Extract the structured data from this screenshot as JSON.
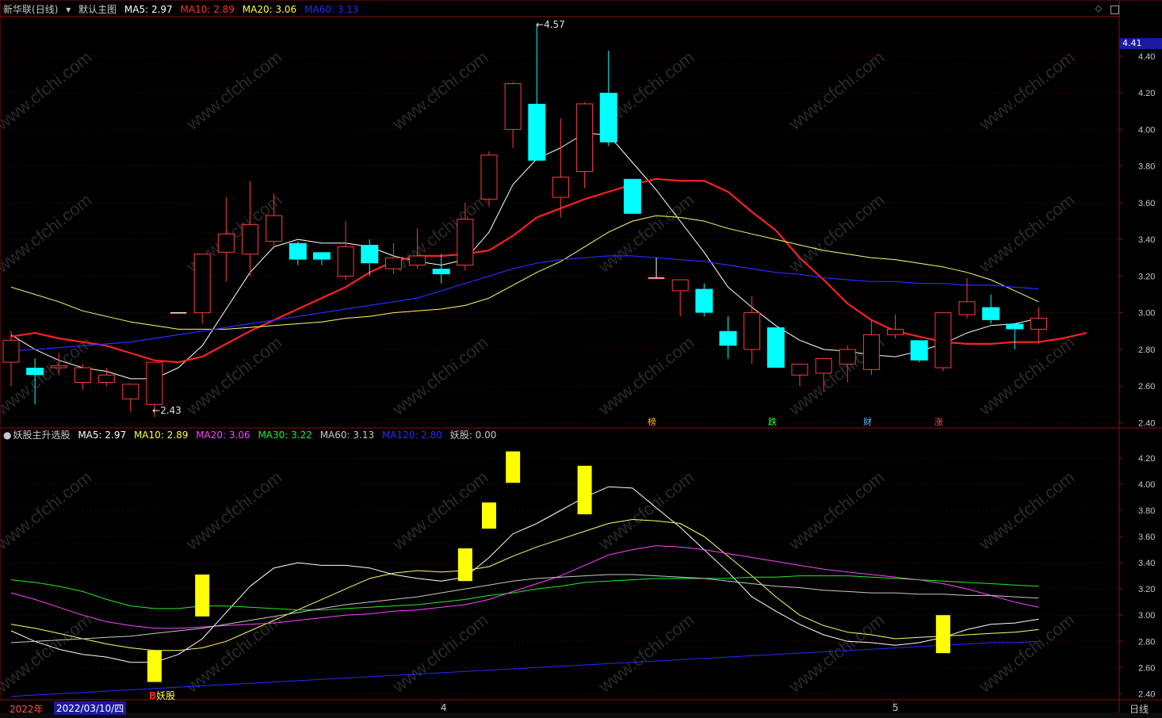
{
  "top_panel": {
    "stock_name": "新华联",
    "period": "(日线)",
    "main_chart_label": "默认主图",
    "ma5": "MA5: 2.97",
    "ma10": "MA10: 2.89",
    "ma20": "MA20: 3.06",
    "ma60": "MA60: 3.13",
    "current_price": "4.41",
    "high_label": "4.57",
    "low_label": "2.43",
    "event_markers": [
      "榜",
      "跌",
      "财",
      "涨"
    ]
  },
  "bottom_panel": {
    "indicator_name": "妖股主升选股",
    "ma5": "MA5: 2.97",
    "ma10": "MA10: 2.89",
    "ma20": "MA20: 3.06",
    "ma30": "MA30: 3.22",
    "ma60": "MA60: 3.13",
    "ma120": "MA120: 2.80",
    "signal": "妖股: 0.00",
    "buy_marker": "B",
    "buy_text": "妖股"
  },
  "date_axis": {
    "year": "2022年",
    "cursor_date": "2022/03/10/四",
    "month_4": "4",
    "month_5": "5",
    "period_button": "日线"
  },
  "watermark": "www.cfchi.com",
  "colors": {
    "up": "#ff3b3b",
    "down": "#00ffff",
    "ma5": "#ffffff",
    "ma10": "#ff2020",
    "ma20": "#ffff66",
    "ma60": "#2a2aff",
    "ma30": "#22ee22",
    "ma20b": "#ff44ff",
    "signal": "#ffff00"
  },
  "chart_data": [
    {
      "type": "candlestick",
      "title": "新华联 (日线)",
      "ylim": [
        2.38,
        4.62
      ],
      "y_ticks": [
        "4.40",
        "4.20",
        "4.00",
        "3.80",
        "3.60",
        "3.40",
        "3.20",
        "3.00",
        "2.80",
        "2.60",
        "2.40"
      ],
      "candles": [
        {
          "o": 2.73,
          "h": 2.9,
          "l": 2.6,
          "c": 2.85
        },
        {
          "o": 2.7,
          "h": 2.75,
          "l": 2.5,
          "c": 2.66
        },
        {
          "o": 2.7,
          "h": 2.78,
          "l": 2.66,
          "c": 2.71
        },
        {
          "o": 2.62,
          "h": 2.72,
          "l": 2.58,
          "c": 2.7
        },
        {
          "o": 2.62,
          "h": 2.7,
          "l": 2.6,
          "c": 2.66
        },
        {
          "o": 2.53,
          "h": 2.61,
          "l": 2.46,
          "c": 2.61
        },
        {
          "o": 2.5,
          "h": 2.73,
          "l": 2.43,
          "c": 2.73
        },
        {
          "o": 3.0,
          "h": 3.0,
          "l": 3.0,
          "c": 3.0
        },
        {
          "o": 3.0,
          "h": 3.32,
          "l": 2.94,
          "c": 3.32
        },
        {
          "o": 3.33,
          "h": 3.63,
          "l": 3.17,
          "c": 3.43
        },
        {
          "o": 3.32,
          "h": 3.72,
          "l": 3.2,
          "c": 3.48
        },
        {
          "o": 3.39,
          "h": 3.65,
          "l": 3.35,
          "c": 3.53
        },
        {
          "o": 3.38,
          "h": 3.39,
          "l": 3.26,
          "c": 3.29
        },
        {
          "o": 3.33,
          "h": 3.33,
          "l": 3.26,
          "c": 3.29
        },
        {
          "o": 3.2,
          "h": 3.5,
          "l": 3.18,
          "c": 3.36
        },
        {
          "o": 3.37,
          "h": 3.4,
          "l": 3.2,
          "c": 3.27
        },
        {
          "o": 3.24,
          "h": 3.38,
          "l": 3.21,
          "c": 3.3
        },
        {
          "o": 3.26,
          "h": 3.46,
          "l": 3.24,
          "c": 3.31
        },
        {
          "o": 3.24,
          "h": 3.32,
          "l": 3.16,
          "c": 3.21
        },
        {
          "o": 3.26,
          "h": 3.6,
          "l": 3.23,
          "c": 3.51
        },
        {
          "o": 3.62,
          "h": 3.88,
          "l": 3.58,
          "c": 3.86
        },
        {
          "o": 4.0,
          "h": 4.26,
          "l": 3.9,
          "c": 4.25
        },
        {
          "o": 4.14,
          "h": 4.57,
          "l": 3.83,
          "c": 3.83
        },
        {
          "o": 3.63,
          "h": 4.06,
          "l": 3.52,
          "c": 3.74
        },
        {
          "o": 3.77,
          "h": 4.15,
          "l": 3.68,
          "c": 4.14
        },
        {
          "o": 4.2,
          "h": 4.43,
          "l": 3.91,
          "c": 3.93
        },
        {
          "o": 3.73,
          "h": 3.73,
          "l": 3.54,
          "c": 3.54
        },
        {
          "o": 3.19,
          "h": 3.19,
          "l": 3.19,
          "c": 3.19
        },
        {
          "o": 3.12,
          "h": 3.18,
          "l": 2.98,
          "c": 3.18
        },
        {
          "o": 3.13,
          "h": 3.16,
          "l": 2.98,
          "c": 3.0
        },
        {
          "o": 2.9,
          "h": 2.98,
          "l": 2.75,
          "c": 2.82
        },
        {
          "o": 2.8,
          "h": 3.09,
          "l": 2.72,
          "c": 3.0
        },
        {
          "o": 2.92,
          "h": 2.92,
          "l": 2.7,
          "c": 2.7
        },
        {
          "o": 2.66,
          "h": 2.72,
          "l": 2.6,
          "c": 2.72
        },
        {
          "o": 2.67,
          "h": 2.75,
          "l": 2.57,
          "c": 2.75
        },
        {
          "o": 2.72,
          "h": 2.82,
          "l": 2.62,
          "c": 2.8
        },
        {
          "o": 2.69,
          "h": 2.96,
          "l": 2.66,
          "c": 2.88
        },
        {
          "o": 2.88,
          "h": 2.99,
          "l": 2.86,
          "c": 2.91
        },
        {
          "o": 2.85,
          "h": 2.85,
          "l": 2.73,
          "c": 2.74
        },
        {
          "o": 2.7,
          "h": 3.0,
          "l": 2.68,
          "c": 3.0
        },
        {
          "o": 2.99,
          "h": 3.19,
          "l": 2.97,
          "c": 3.06
        },
        {
          "o": 3.03,
          "h": 3.1,
          "l": 2.94,
          "c": 2.96
        },
        {
          "o": 2.94,
          "h": 2.94,
          "l": 2.8,
          "c": 2.91
        },
        {
          "o": 2.91,
          "h": 3.03,
          "l": 2.83,
          "c": 2.97
        }
      ],
      "series": [
        {
          "name": "MA5",
          "values": [
            2.88,
            2.8,
            2.74,
            2.7,
            2.68,
            2.64,
            2.64,
            2.7,
            2.82,
            3.02,
            3.22,
            3.36,
            3.4,
            3.38,
            3.38,
            3.36,
            3.31,
            3.28,
            3.26,
            3.29,
            3.44,
            3.7,
            3.84,
            3.9,
            3.98,
            3.97,
            3.82,
            3.67,
            3.5,
            3.33,
            3.14,
            3.03,
            2.93,
            2.85,
            2.8,
            2.79,
            2.77,
            2.76,
            2.79,
            2.83,
            2.89,
            2.93,
            2.94,
            2.97
          ]
        },
        {
          "name": "MA10",
          "values": [
            2.87,
            2.89,
            2.86,
            2.84,
            2.82,
            2.78,
            2.74,
            2.73,
            2.76,
            2.83,
            2.9,
            2.96,
            3.02,
            3.08,
            3.14,
            3.22,
            3.28,
            3.31,
            3.31,
            3.32,
            3.34,
            3.42,
            3.52,
            3.57,
            3.62,
            3.66,
            3.7,
            3.73,
            3.72,
            3.72,
            3.66,
            3.55,
            3.45,
            3.3,
            3.18,
            3.05,
            2.96,
            2.9,
            2.87,
            2.84,
            2.83,
            2.83,
            2.84,
            2.84,
            2.86,
            2.89
          ]
        },
        {
          "name": "MA20",
          "values": [
            3.14,
            3.1,
            3.06,
            3.01,
            2.98,
            2.95,
            2.93,
            2.91,
            2.91,
            2.91,
            2.92,
            2.93,
            2.94,
            2.95,
            2.97,
            2.98,
            3.0,
            3.01,
            3.02,
            3.04,
            3.08,
            3.15,
            3.22,
            3.28,
            3.36,
            3.44,
            3.5,
            3.53,
            3.52,
            3.5,
            3.46,
            3.43,
            3.4,
            3.37,
            3.34,
            3.32,
            3.3,
            3.29,
            3.27,
            3.25,
            3.22,
            3.18,
            3.12,
            3.06
          ]
        },
        {
          "name": "MA60",
          "values": [
            2.79,
            2.8,
            2.81,
            2.82,
            2.83,
            2.84,
            2.86,
            2.88,
            2.9,
            2.92,
            2.94,
            2.96,
            2.98,
            3.0,
            3.02,
            3.04,
            3.06,
            3.08,
            3.12,
            3.16,
            3.2,
            3.24,
            3.27,
            3.29,
            3.3,
            3.31,
            3.31,
            3.3,
            3.29,
            3.28,
            3.26,
            3.24,
            3.22,
            3.21,
            3.19,
            3.18,
            3.17,
            3.17,
            3.16,
            3.16,
            3.15,
            3.15,
            3.14,
            3.13
          ]
        }
      ]
    },
    {
      "type": "line",
      "title": "妖股主升选股",
      "ylim": [
        2.36,
        4.32
      ],
      "y_ticks": [
        "4.20",
        "4.00",
        "3.80",
        "3.60",
        "3.40",
        "3.20",
        "3.00",
        "2.80",
        "2.60",
        "2.40"
      ],
      "signal_bars": [
        {
          "index": 6,
          "low": 2.49,
          "high": 2.73
        },
        {
          "index": 8,
          "low": 2.99,
          "high": 3.31
        },
        {
          "index": 19,
          "low": 3.26,
          "high": 3.51
        },
        {
          "index": 20,
          "low": 3.66,
          "high": 3.86
        },
        {
          "index": 21,
          "low": 4.01,
          "high": 4.25
        },
        {
          "index": 24,
          "low": 3.77,
          "high": 4.14
        },
        {
          "index": 39,
          "low": 2.71,
          "high": 3.0
        }
      ],
      "series": [
        {
          "name": "MA5",
          "values": [
            2.88,
            2.8,
            2.74,
            2.7,
            2.68,
            2.64,
            2.64,
            2.7,
            2.82,
            3.02,
            3.22,
            3.36,
            3.4,
            3.38,
            3.38,
            3.36,
            3.31,
            3.28,
            3.26,
            3.29,
            3.44,
            3.62,
            3.7,
            3.8,
            3.9,
            3.98,
            3.97,
            3.82,
            3.67,
            3.5,
            3.33,
            3.14,
            3.03,
            2.93,
            2.85,
            2.8,
            2.79,
            2.77,
            2.79,
            2.83,
            2.89,
            2.93,
            2.94,
            2.97
          ]
        },
        {
          "name": "MA10",
          "values": [
            2.93,
            2.9,
            2.86,
            2.82,
            2.78,
            2.75,
            2.73,
            2.73,
            2.75,
            2.8,
            2.88,
            2.96,
            3.04,
            3.12,
            3.2,
            3.28,
            3.32,
            3.34,
            3.33,
            3.34,
            3.37,
            3.45,
            3.52,
            3.58,
            3.64,
            3.7,
            3.73,
            3.72,
            3.7,
            3.6,
            3.45,
            3.3,
            3.14,
            3.0,
            2.92,
            2.87,
            2.85,
            2.82,
            2.83,
            2.84,
            2.85,
            2.86,
            2.87,
            2.89
          ]
        },
        {
          "name": "MA20",
          "values": [
            3.17,
            3.12,
            3.06,
            3.0,
            2.95,
            2.92,
            2.9,
            2.9,
            2.91,
            2.92,
            2.93,
            2.94,
            2.96,
            2.98,
            3.0,
            3.01,
            3.03,
            3.04,
            3.06,
            3.08,
            3.12,
            3.18,
            3.24,
            3.3,
            3.38,
            3.46,
            3.5,
            3.53,
            3.52,
            3.5,
            3.47,
            3.44,
            3.41,
            3.38,
            3.35,
            3.33,
            3.31,
            3.29,
            3.27,
            3.24,
            3.2,
            3.15,
            3.1,
            3.06
          ]
        },
        {
          "name": "MA30",
          "values": [
            3.27,
            3.25,
            3.22,
            3.18,
            3.12,
            3.07,
            3.05,
            3.05,
            3.07,
            3.07,
            3.06,
            3.05,
            3.04,
            3.04,
            3.05,
            3.06,
            3.07,
            3.08,
            3.1,
            3.12,
            3.15,
            3.17,
            3.2,
            3.22,
            3.25,
            3.26,
            3.27,
            3.28,
            3.28,
            3.28,
            3.28,
            3.29,
            3.29,
            3.3,
            3.3,
            3.3,
            3.29,
            3.28,
            3.27,
            3.26,
            3.25,
            3.24,
            3.23,
            3.22
          ]
        },
        {
          "name": "MA60",
          "values": [
            2.79,
            2.8,
            2.81,
            2.82,
            2.83,
            2.84,
            2.86,
            2.88,
            2.9,
            2.93,
            2.96,
            2.99,
            3.02,
            3.05,
            3.08,
            3.1,
            3.12,
            3.14,
            3.17,
            3.2,
            3.23,
            3.26,
            3.28,
            3.29,
            3.3,
            3.31,
            3.31,
            3.3,
            3.29,
            3.28,
            3.26,
            3.24,
            3.22,
            3.21,
            3.19,
            3.18,
            3.17,
            3.17,
            3.16,
            3.16,
            3.15,
            3.15,
            3.14,
            3.13
          ]
        },
        {
          "name": "MA120",
          "values": [
            2.38,
            2.39,
            2.4,
            2.41,
            2.42,
            2.43,
            2.44,
            2.45,
            2.46,
            2.47,
            2.48,
            2.49,
            2.5,
            2.51,
            2.52,
            2.53,
            2.54,
            2.55,
            2.56,
            2.57,
            2.58,
            2.59,
            2.6,
            2.61,
            2.62,
            2.63,
            2.64,
            2.65,
            2.66,
            2.67,
            2.68,
            2.69,
            2.7,
            2.71,
            2.72,
            2.73,
            2.74,
            2.75,
            2.76,
            2.77,
            2.78,
            2.79,
            2.79,
            2.8
          ]
        }
      ]
    }
  ]
}
